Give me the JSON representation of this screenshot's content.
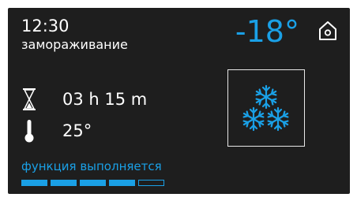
{
  "header": {
    "time": "12:30",
    "mode": "замораживание",
    "setpoint": "-18°"
  },
  "icons": {
    "home": "home-icon",
    "timer": "hourglass-icon",
    "temperature": "thermometer-icon",
    "program": "snowflakes-icon"
  },
  "timer": {
    "remaining": "03 h 15 m"
  },
  "temperature": {
    "current": "25°"
  },
  "status": {
    "text": "функция выполняется"
  },
  "progress": {
    "segments_total": 5,
    "segments_filled": 4
  },
  "colors": {
    "accent": "#1aa0e6",
    "background": "#1e1e1e",
    "text": "#ffffff"
  }
}
